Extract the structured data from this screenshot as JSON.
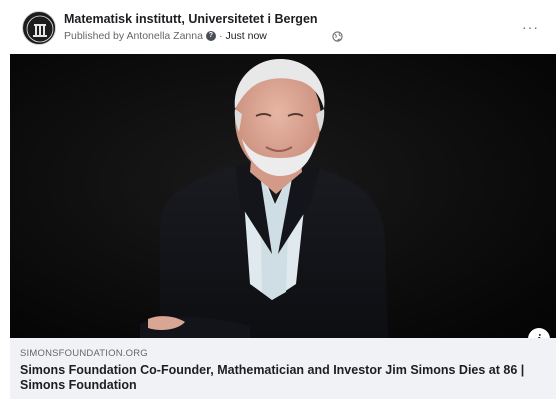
{
  "post": {
    "page_name": "Matematisk institutt, Universitetet i Bergen",
    "published_by": "Published by Antonella Zanna",
    "separator": "·",
    "timestamp": "Just now",
    "privacy_icon": "globe-icon",
    "more_icon": "more-horizontal-icon"
  },
  "photo": {
    "description_icon": "portrait-photo",
    "info_icon": "i"
  },
  "link_preview": {
    "domain": "SIMONSFOUNDATION.ORG",
    "title": "Simons Foundation Co-Founder, Mathematician and Investor Jim Simons Dies at 86 | Simons Foundation"
  },
  "colors": {
    "text_primary": "#1c1e21",
    "text_secondary": "#65676b",
    "preview_bg": "#f0f2f5",
    "photo_bg": "#0b0b0b"
  }
}
